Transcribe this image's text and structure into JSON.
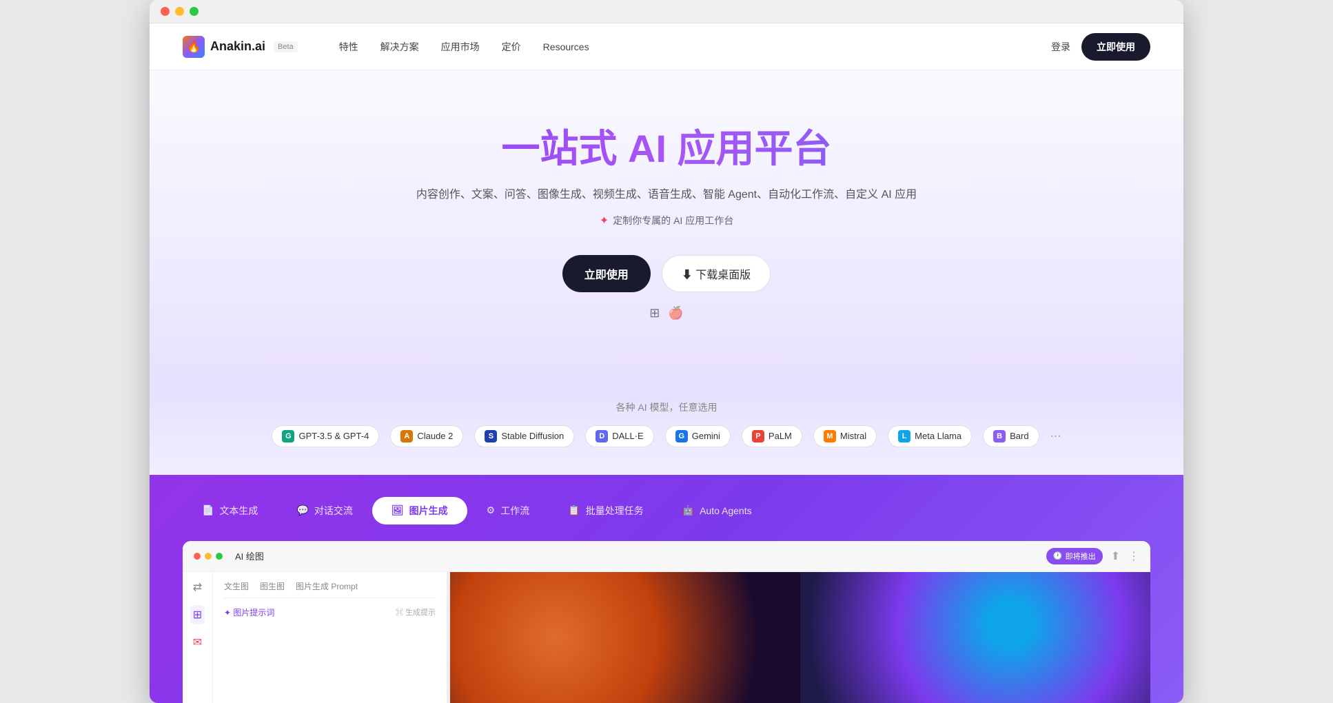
{
  "browser": {
    "dots": [
      "red",
      "yellow",
      "green"
    ]
  },
  "navbar": {
    "logo_text": "Anakin.ai",
    "beta_label": "Beta",
    "nav_items": [
      {
        "label": "特性",
        "has_arrow": true
      },
      {
        "label": "解决方案",
        "has_arrow": true
      },
      {
        "label": "应用市场",
        "has_arrow": false
      },
      {
        "label": "定价",
        "has_arrow": false
      },
      {
        "label": "Resources",
        "has_arrow": true
      }
    ],
    "login_label": "登录",
    "cta_label": "立即使用"
  },
  "hero": {
    "title": "一站式 AI 应用平台",
    "subtitle": "内容创作、文案、问答、图像生成、视频生成、语音生成、智能 Agent、自动化工作流、自定义 AI 应用",
    "tagline": "定制你专属的 AI 应用工作台",
    "btn_primary": "立即使用",
    "btn_secondary": "⬇ 下载桌面版"
  },
  "models": {
    "label": "各种 AI 模型，任意选用",
    "items": [
      {
        "label": "GPT-3.5 & GPT-4",
        "icon_text": "G",
        "icon_class": "icon-gpt"
      },
      {
        "label": "Claude 2",
        "icon_text": "A",
        "icon_class": "icon-claude"
      },
      {
        "label": "Stable Diffusion",
        "icon_text": "S",
        "icon_class": "icon-stable"
      },
      {
        "label": "DALL·E",
        "icon_text": "D",
        "icon_class": "icon-dalle"
      },
      {
        "label": "Gemini",
        "icon_text": "G",
        "icon_class": "icon-gemini"
      },
      {
        "label": "PaLM",
        "icon_text": "P",
        "icon_class": "icon-palm"
      },
      {
        "label": "Mistral",
        "icon_text": "M",
        "icon_class": "icon-mistral"
      },
      {
        "label": "Meta Llama",
        "icon_text": "L",
        "icon_class": "icon-llama"
      },
      {
        "label": "Bard",
        "icon_text": "B",
        "icon_class": "icon-bard"
      },
      {
        "label": "···",
        "icon_text": "",
        "icon_class": ""
      }
    ]
  },
  "bottom_section": {
    "tabs": [
      {
        "label": "文本生成",
        "icon": "📄",
        "active": false
      },
      {
        "label": "对话交流",
        "icon": "💬",
        "active": false
      },
      {
        "label": "图片生成",
        "icon": "🖼",
        "active": true
      },
      {
        "label": "工作流",
        "icon": "⚙",
        "active": false
      },
      {
        "label": "批量处理任务",
        "icon": "📋",
        "active": false
      },
      {
        "label": "Auto Agents",
        "icon": "🤖",
        "active": false
      }
    ]
  },
  "app_preview": {
    "title": "AI 绘图",
    "titlebar_dots": [
      "red",
      "yellow",
      "green"
    ],
    "coming_soon": "即将推出",
    "tabs": [
      "文生图",
      "图生图",
      "图片生成 Prompt"
    ],
    "prompt_label": "✦ 图片提示词",
    "generate_hint": "⌘ 生成提示",
    "left_icons": [
      "⇄",
      "⊞",
      "✉"
    ]
  }
}
